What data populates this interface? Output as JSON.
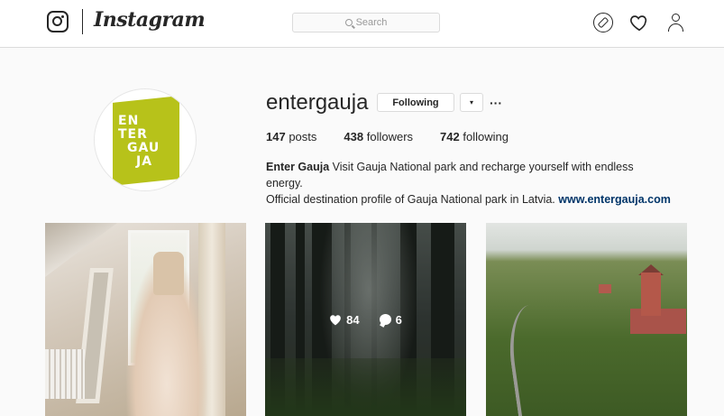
{
  "header": {
    "brand": "Instagram",
    "search_placeholder": "Search",
    "icons": [
      "compass-icon",
      "heart-icon",
      "person-icon"
    ]
  },
  "profile": {
    "avatar_text": [
      "EN",
      "TER",
      "GAU",
      "JA"
    ],
    "avatar_color": "#b7c21a",
    "username": "entergauja",
    "following_button": "Following",
    "dropdown_glyph": "▾",
    "more_glyph": "···",
    "stats": {
      "posts_count": "147",
      "posts_label": "posts",
      "followers_count": "438",
      "followers_label": "followers",
      "following_count": "742",
      "following_label": "following"
    },
    "bio": {
      "name": "Enter Gauja",
      "line1": "Visit Gauja National park and recharge yourself with endless energy.",
      "line2": "Official destination profile of Gauja National park in Latvia.",
      "link": "www.entergauja.com"
    }
  },
  "posts": [
    {
      "subject": "wedding dress by window"
    },
    {
      "subject": "misty forest",
      "likes": "84",
      "comments": "6"
    },
    {
      "subject": "aerial view of castle and road"
    }
  ]
}
